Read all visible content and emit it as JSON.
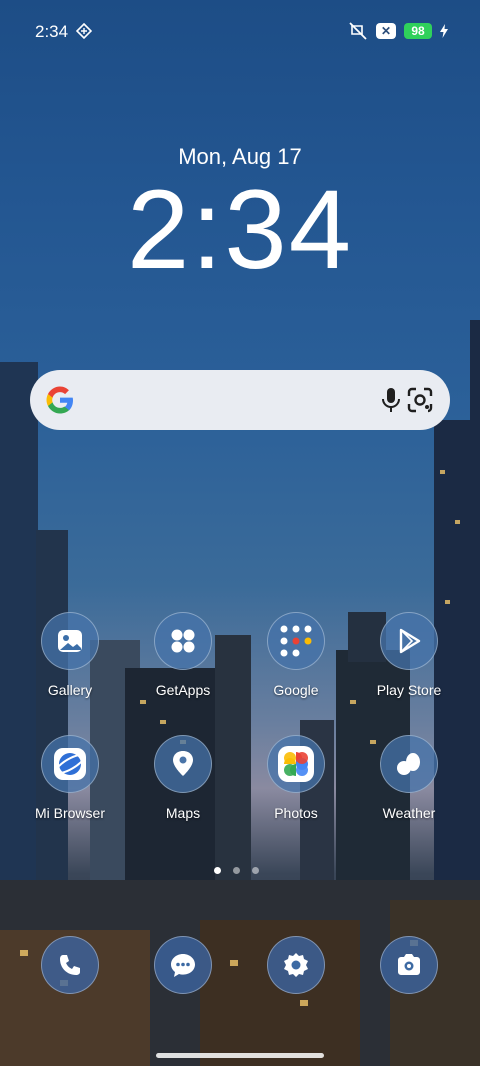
{
  "status": {
    "time": "2:34",
    "battery": "98",
    "x_badge": "✕"
  },
  "lockscreen": {
    "date": "Mon, Aug 17",
    "time": "2:34"
  },
  "search": {
    "icons": [
      "google-logo",
      "mic-icon",
      "lens-icon"
    ]
  },
  "apps": [
    {
      "label": "Gallery",
      "icon": "gallery-icon"
    },
    {
      "label": "GetApps",
      "icon": "getapps-icon"
    },
    {
      "label": "Google",
      "icon": "google-folder-icon"
    },
    {
      "label": "Play Store",
      "icon": "play-store-icon"
    },
    {
      "label": "Mi Browser",
      "icon": "mi-browser-icon"
    },
    {
      "label": "Maps",
      "icon": "maps-icon"
    },
    {
      "label": "Photos",
      "icon": "photos-icon"
    },
    {
      "label": "Weather",
      "icon": "weather-icon"
    }
  ],
  "dock": [
    {
      "icon": "phone-icon"
    },
    {
      "icon": "messages-icon"
    },
    {
      "icon": "settings-icon"
    },
    {
      "icon": "camera-icon"
    }
  ],
  "pager": {
    "pages": 3,
    "active": 1
  }
}
